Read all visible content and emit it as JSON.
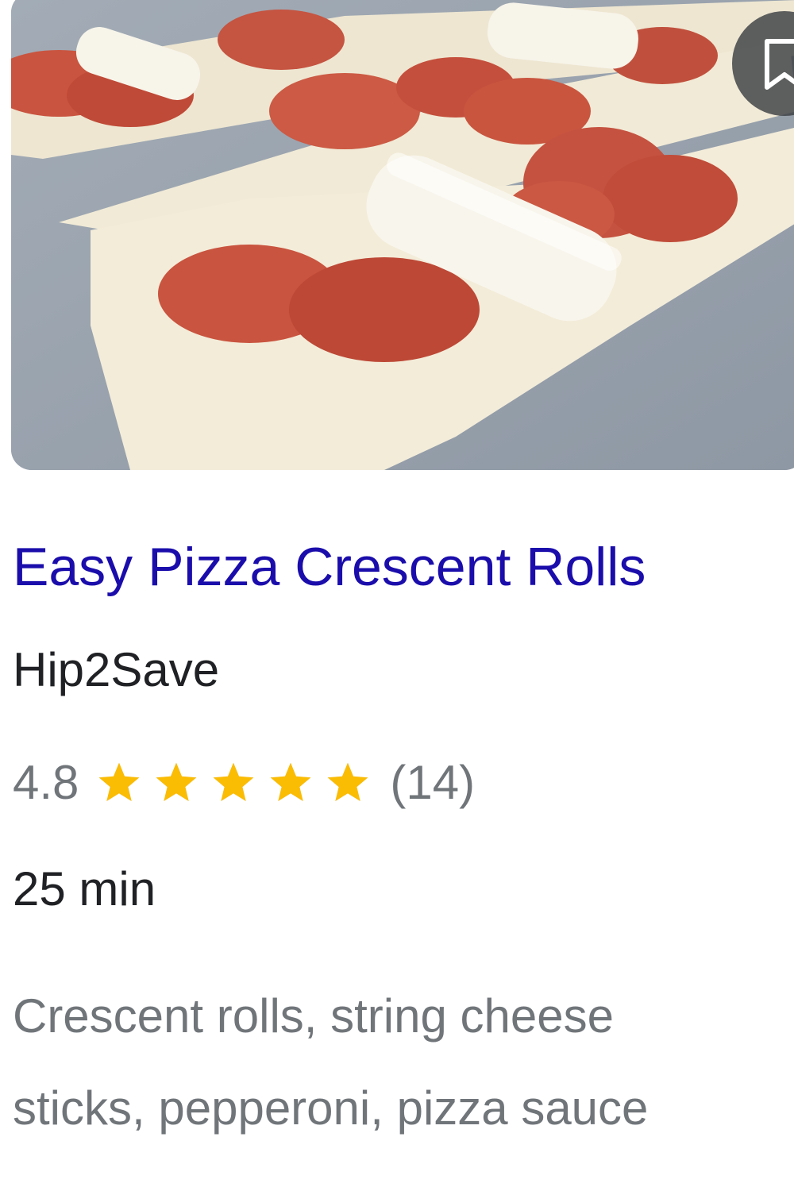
{
  "result": {
    "image": {
      "subject": "crescent dough strips with pepperoni slices and string cheese sticks",
      "colors": {
        "background": "#98a2ad",
        "dough": "#f3ecd9",
        "pepperoni": "#c9543f",
        "cheese": "#f7f4ea"
      }
    },
    "save_icon": "bookmark-icon",
    "title": "Easy Pizza Crescent Rolls",
    "source": "Hip2Save",
    "rating": {
      "value": "4.8",
      "stars": 4.8,
      "stars_max": 5,
      "star_color": "#fbbc04",
      "review_count": "(14)"
    },
    "duration": "25 min",
    "ingredients": {
      "line1": "Crescent rolls, string cheese",
      "line2": "sticks, pepperoni, pizza sauce"
    },
    "colors": {
      "title": "#1a0dab",
      "source": "#202124",
      "meta": "#70757a"
    }
  }
}
